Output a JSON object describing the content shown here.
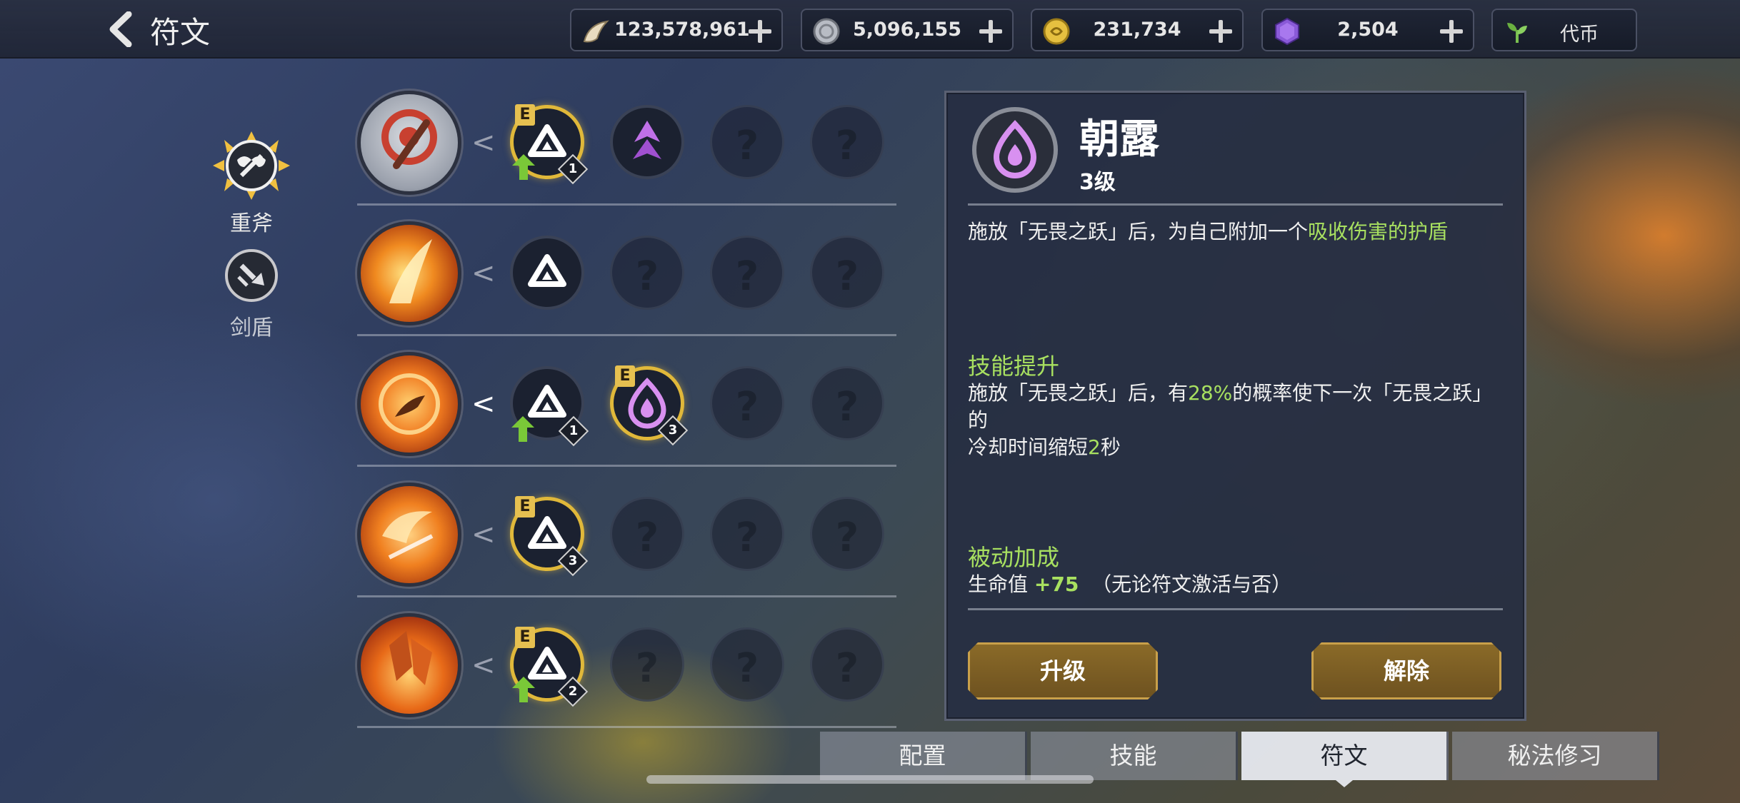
{
  "header": {
    "title": "符文",
    "resources": [
      {
        "icon": "horn-icon",
        "value": "123,578,961"
      },
      {
        "icon": "silver-coin-icon",
        "value": "5,096,155"
      },
      {
        "icon": "gold-coin-icon",
        "value": "231,734"
      },
      {
        "icon": "purple-gem-icon",
        "value": "2,504"
      },
      {
        "icon": "sprout-icon",
        "label": "代币"
      }
    ]
  },
  "categories": [
    {
      "label": "重斧",
      "selected": true
    },
    {
      "label": "剑盾",
      "selected": false
    }
  ],
  "rune_rows": [
    {
      "skill": "axe-skill-icon",
      "slots": [
        {
          "state": "equipped",
          "e": "E",
          "level": "1",
          "upgrade": true
        },
        {
          "state": "owned"
        },
        {
          "state": "locked",
          "q": "?"
        },
        {
          "state": "locked",
          "q": "?"
        }
      ]
    },
    {
      "skill": "flame-slash-skill-icon",
      "slots": [
        {
          "state": "owned"
        },
        {
          "state": "locked",
          "q": "?"
        },
        {
          "state": "locked",
          "q": "?"
        },
        {
          "state": "locked",
          "q": "?"
        }
      ]
    },
    {
      "skill": "leap-skill-icon",
      "active": true,
      "slots": [
        {
          "state": "owned",
          "level": "1",
          "upgrade": true
        },
        {
          "state": "equipped",
          "e": "E",
          "level": "3",
          "rune": "dew"
        },
        {
          "state": "locked",
          "q": "?"
        },
        {
          "state": "locked",
          "q": "?"
        }
      ]
    },
    {
      "skill": "spin-skill-icon",
      "slots": [
        {
          "state": "equipped",
          "e": "E",
          "level": "3"
        },
        {
          "state": "locked",
          "q": "?"
        },
        {
          "state": "locked",
          "q": "?"
        },
        {
          "state": "locked",
          "q": "?"
        }
      ]
    },
    {
      "skill": "earth-shatter-skill-icon",
      "slots": [
        {
          "state": "equipped",
          "e": "E",
          "level": "2",
          "upgrade": true
        },
        {
          "state": "locked",
          "q": "?"
        },
        {
          "state": "locked",
          "q": "?"
        },
        {
          "state": "locked",
          "q": "?"
        }
      ]
    }
  ],
  "detail": {
    "name": "朝露",
    "level": "3级",
    "desc_pre": "施放「无畏之跃」后，为自己附加一个",
    "desc_hl": "吸收伤害的护盾",
    "skill_title": "技能提升",
    "skill_pre": "施放「无畏之跃」后，有",
    "skill_pct": "28%",
    "skill_mid": "的概率使下一次「无畏之跃」的",
    "skill_line2_pre": "冷却时间缩短",
    "skill_sec": "2",
    "skill_line2_post": "秒",
    "passive_title": "被动加成",
    "passive_label": "生命值",
    "passive_value": "+75",
    "passive_note": "（无论符文激活与否）",
    "btn_upgrade": "升级",
    "btn_remove": "解除"
  },
  "tabs": [
    {
      "label": "配置"
    },
    {
      "label": "技能"
    },
    {
      "label": "符文",
      "active": true
    },
    {
      "label": "秘法修习"
    }
  ],
  "colors": {
    "accent_green": "#a8e060",
    "gold": "#e0b83a",
    "button": "#8a6a28"
  }
}
